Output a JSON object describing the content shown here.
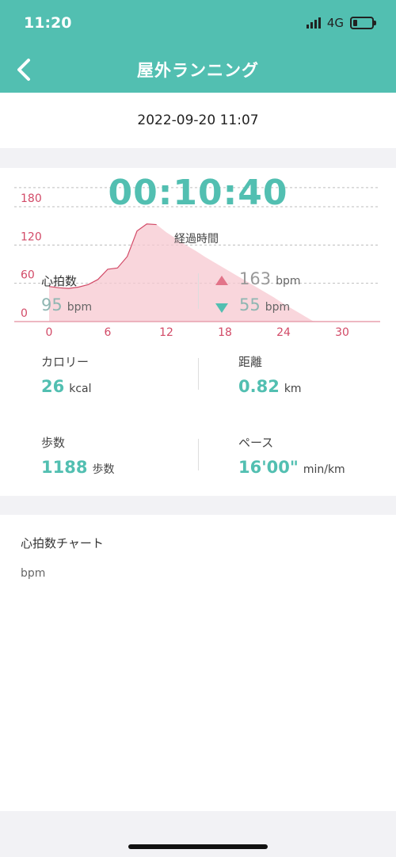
{
  "status_bar": {
    "time": "11:20",
    "network": "4G"
  },
  "header": {
    "title": "屋外ランニング"
  },
  "date": "2022-09-20 11:07",
  "summary": {
    "duration": "00:10:40",
    "duration_label": "経過時間",
    "heart_rate_label": "心拍数",
    "avg_hr": "95",
    "max_hr": "163",
    "min_hr": "55",
    "bpm_unit": "bpm"
  },
  "colors": {
    "accent": "#52bfb1",
    "chart_red": "#d24a67",
    "chart_fill": "#f7c8d0"
  },
  "chart_data": {
    "type": "area",
    "x": [
      0,
      1,
      2,
      3,
      4,
      5,
      6,
      7,
      8,
      9,
      10,
      11,
      12,
      13,
      14,
      15,
      16,
      17,
      18,
      19,
      20,
      21,
      22,
      23,
      24,
      25,
      26,
      27,
      28,
      29,
      30,
      31
    ],
    "y": [
      55,
      53,
      52,
      54,
      58,
      66,
      82,
      84,
      102,
      142,
      153,
      152,
      140,
      130,
      120,
      111,
      101,
      92,
      83,
      74,
      65,
      56,
      47,
      38,
      28,
      19,
      10,
      1,
      0,
      0,
      0,
      0
    ],
    "xticks": [
      "0",
      "6",
      "12",
      "18",
      "24",
      "30"
    ],
    "yticks": [
      "0",
      "60",
      "120",
      "180"
    ],
    "xlim": [
      0,
      31
    ],
    "ylim": [
      0,
      180
    ],
    "grid": true
  },
  "stats": {
    "calories": {
      "label": "カロリー",
      "value": "26",
      "unit": "kcal"
    },
    "distance": {
      "label": "距離",
      "value": "0.82",
      "unit": "km"
    },
    "steps": {
      "label": "歩数",
      "value": "1188",
      "unit": "歩数"
    },
    "pace": {
      "label": "ペース",
      "value": "16'00\"",
      "unit": "min/km"
    }
  },
  "hr_chart": {
    "title": "心拍数チャート",
    "unit": "bpm"
  }
}
